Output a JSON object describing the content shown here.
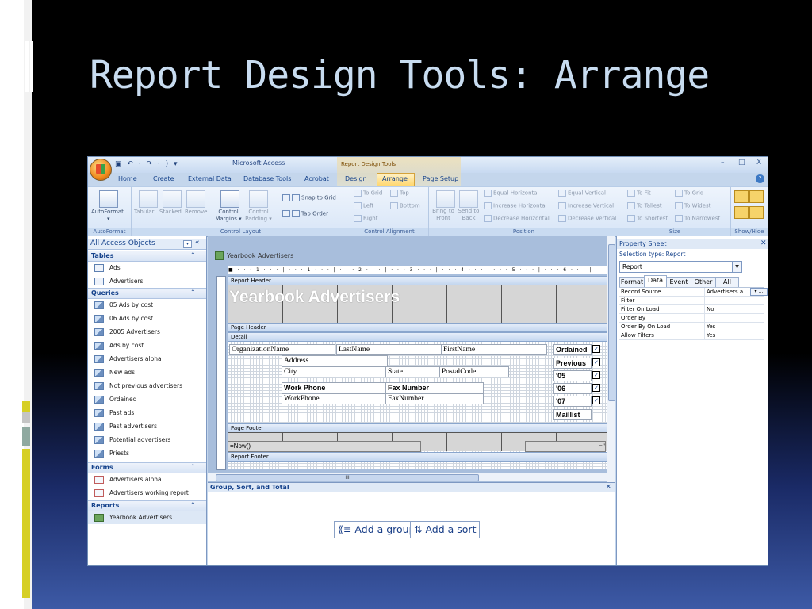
{
  "slide": {
    "title": "Report Design Tools: Arrange"
  },
  "window": {
    "title": "Microsoft Access",
    "context_tab": "Report Design Tools",
    "qat": "▣ ↶ · ↷ · ) ▾",
    "min": "–",
    "max": "□",
    "close": "X"
  },
  "tabs": [
    "Home",
    "Create",
    "External Data",
    "Database Tools",
    "Acrobat",
    "Design",
    "Arrange",
    "Page Setup"
  ],
  "ribbon": {
    "autoformat": {
      "label": "AutoFormat",
      "group": "AutoFormat"
    },
    "control_layout": {
      "group": "Control Layout",
      "tabular": "Tabular",
      "stacked": "Stacked",
      "remove": "Remove",
      "margins": "Control Margins ▾",
      "padding": "Control Padding ▾",
      "snap": "Snap to Grid",
      "taborder": "Tab Order"
    },
    "control_alignment": {
      "group": "Control Alignment",
      "togrid": "To Grid",
      "left": "Left",
      "right": "Right",
      "top": "Top",
      "bottom": "Bottom"
    },
    "position": {
      "group": "Position",
      "bring": "Bring to Front",
      "send": "Send to Back",
      "eq_h": "Equal Horizontal",
      "inc_h": "Increase Horizontal",
      "dec_h": "Decrease Horizontal",
      "eq_v": "Equal Vertical",
      "inc_v": "Increase Vertical",
      "dec_v": "Decrease Vertical"
    },
    "size": {
      "group": "Size",
      "tofit": "To Fit",
      "tallest": "To Tallest",
      "shortest": "To Shortest",
      "togrid": "To Grid",
      "widest": "To Widest",
      "narrowest": "To Narrowest"
    },
    "showhide": {
      "group": "Show/Hide"
    }
  },
  "nav": {
    "header": "All Access Objects",
    "sections": [
      {
        "name": "Tables",
        "items": [
          "Ads",
          "Advertisers"
        ]
      },
      {
        "name": "Queries",
        "items": [
          "05 Ads by cost",
          "06 Ads by cost",
          "2005 Advertisers",
          "Ads by cost",
          "Advertisers alpha",
          "New ads",
          "Not previous advertisers",
          "Ordained",
          "Past ads",
          "Past advertisers",
          "Potential advertisers",
          "Priests"
        ]
      },
      {
        "name": "Forms",
        "items": [
          "Advertisers alpha",
          "Advertisers working report"
        ]
      },
      {
        "name": "Reports",
        "items": [
          "Yearbook Advertisers"
        ]
      }
    ]
  },
  "document": {
    "tab": "Yearbook Advertisers",
    "ruler": "■ · · · 1 · · · | · · · 1 · · · | · · · 2 · · · | · · · 3 · · · | · · · 4 · · · | · · · 5 · · · | · · · 6 · · · |",
    "bands": {
      "report_header": "Report Header",
      "page_header": "Page Header",
      "detail": "Detail",
      "page_footer": "Page Footer",
      "report_footer": "Report Footer"
    },
    "report_title": "Yearbook Advertisers",
    "fields": {
      "org": "OrganizationName",
      "last": "LastName",
      "first": "FirstName",
      "address": "Address",
      "city": "City",
      "state": "State",
      "postal": "PostalCode",
      "work_phone_lbl": "Work Phone",
      "work_phone": "WorkPhone",
      "fax_lbl": "Fax Number",
      "fax": "FaxNumber",
      "ordained": "Ordained",
      "previous": "Previous",
      "y05": "'05",
      "y06": "'06",
      "y07": "'07",
      "maillist": "Maillist"
    },
    "footer_expr": "=Now()",
    "footer_right": "=\"",
    "hscroll_grip": "III"
  },
  "gst": {
    "title": "Group, Sort, and Total",
    "add_group": "Add a group",
    "add_sort": "Add a sort"
  },
  "property_sheet": {
    "title": "Property Sheet",
    "selection": "Selection type:  Report",
    "combo": "Report",
    "tabs": [
      "Format",
      "Data",
      "Event",
      "Other",
      "All"
    ],
    "rows": [
      {
        "k": "Record Source",
        "v": "Advertisers a"
      },
      {
        "k": "Filter",
        "v": ""
      },
      {
        "k": "Filter On Load",
        "v": "No"
      },
      {
        "k": "Order By",
        "v": ""
      },
      {
        "k": "Order By On Load",
        "v": "Yes"
      },
      {
        "k": "Allow Filters",
        "v": "Yes"
      }
    ]
  }
}
